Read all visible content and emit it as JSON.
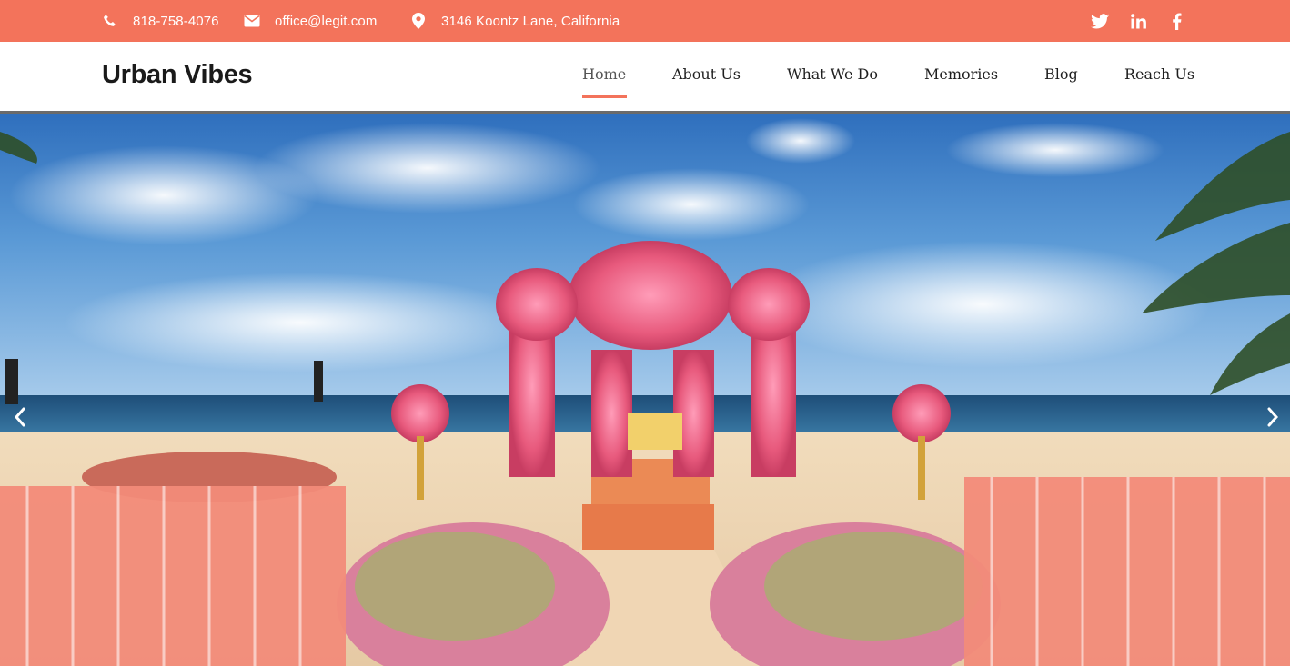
{
  "topbar": {
    "phone": "818-758-4076",
    "email": "office@legit.com",
    "address": "3146 Koontz Lane, California",
    "icons": [
      "phone-icon",
      "envelope-icon",
      "map-marker-icon"
    ],
    "social": [
      "twitter-icon",
      "linkedin-icon",
      "facebook-icon"
    ],
    "background": "#f3735b"
  },
  "header": {
    "logo": "Urban Vibes",
    "nav": [
      {
        "label": "Home",
        "active": true
      },
      {
        "label": "About Us",
        "active": false
      },
      {
        "label": "What We Do",
        "active": false
      },
      {
        "label": "Memories",
        "active": false
      },
      {
        "label": "Blog",
        "active": false
      },
      {
        "label": "Reach Us",
        "active": false
      }
    ],
    "accent": "#f3735b"
  },
  "hero": {
    "controls": [
      "chevron-left-icon",
      "chevron-right-icon"
    ]
  }
}
